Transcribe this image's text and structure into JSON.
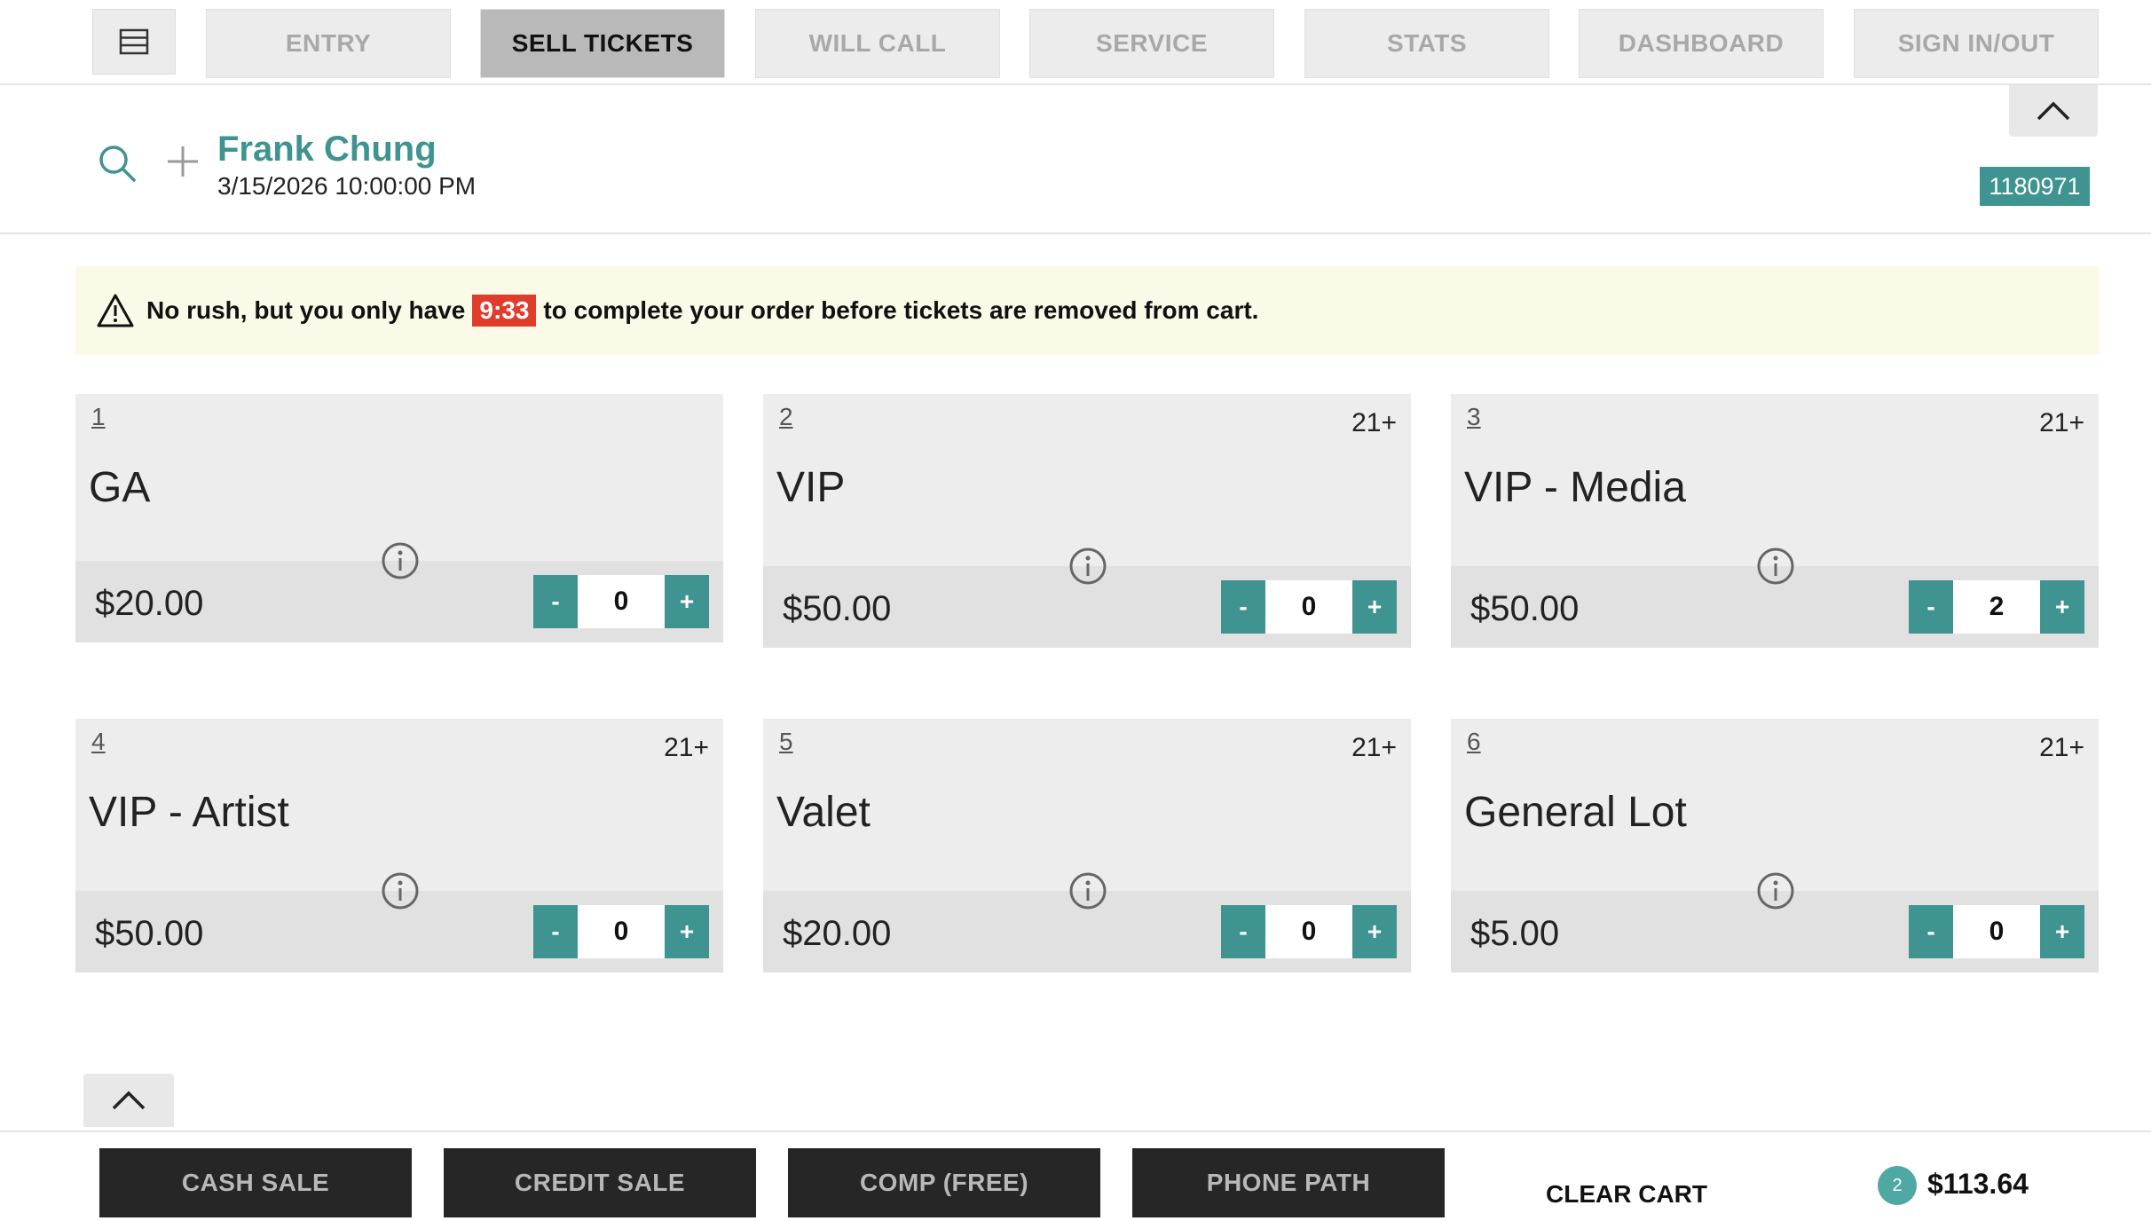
{
  "nav": {
    "tabs": [
      {
        "label": "ENTRY",
        "active": false
      },
      {
        "label": "SELL TICKETS",
        "active": true
      },
      {
        "label": "WILL CALL",
        "active": false
      },
      {
        "label": "SERVICE",
        "active": false
      },
      {
        "label": "STATS",
        "active": false
      },
      {
        "label": "DASHBOARD",
        "active": false
      },
      {
        "label": "SIGN IN/OUT",
        "active": false
      }
    ]
  },
  "header": {
    "customer_name": "Frank Chung",
    "datetime": "3/15/2026 10:00:00 PM",
    "order_id": "1180971"
  },
  "warning": {
    "before": "No rush, but you only have",
    "timer": "9:33",
    "after": "to complete your order before tickets are removed from cart."
  },
  "tickets": [
    {
      "num": "1",
      "age": "",
      "name": "GA",
      "price": "$20.00",
      "qty": "0",
      "minus": "-",
      "plus": "+"
    },
    {
      "num": "2",
      "age": "21+",
      "name": "VIP",
      "price": "$50.00",
      "qty": "0",
      "minus": "-",
      "plus": "+"
    },
    {
      "num": "3",
      "age": "21+",
      "name": "VIP - Media",
      "price": "$50.00",
      "qty": "2",
      "minus": "-",
      "plus": "+"
    },
    {
      "num": "4",
      "age": "21+",
      "name": "VIP - Artist",
      "price": "$50.00",
      "qty": "0",
      "minus": "-",
      "plus": "+"
    },
    {
      "num": "5",
      "age": "21+",
      "name": "Valet",
      "price": "$20.00",
      "qty": "0",
      "minus": "-",
      "plus": "+"
    },
    {
      "num": "6",
      "age": "21+",
      "name": "General Lot",
      "price": "$5.00",
      "qty": "0",
      "minus": "-",
      "plus": "+"
    }
  ],
  "footer": {
    "cash_sale": "CASH SALE",
    "credit_sale": "CREDIT SALE",
    "comp": "COMP (FREE)",
    "phone_path": "PHONE PATH",
    "clear_cart": "CLEAR CART",
    "cart_count": "2",
    "cart_total": "$113.64"
  },
  "colors": {
    "accent": "#3f9390",
    "timer": "#e03c2c",
    "warning_bg": "#fbf9e7"
  },
  "icons": [
    "menu-icon",
    "search-icon",
    "plus-icon",
    "chevron-up-icon",
    "warning-icon",
    "info-icon"
  ]
}
